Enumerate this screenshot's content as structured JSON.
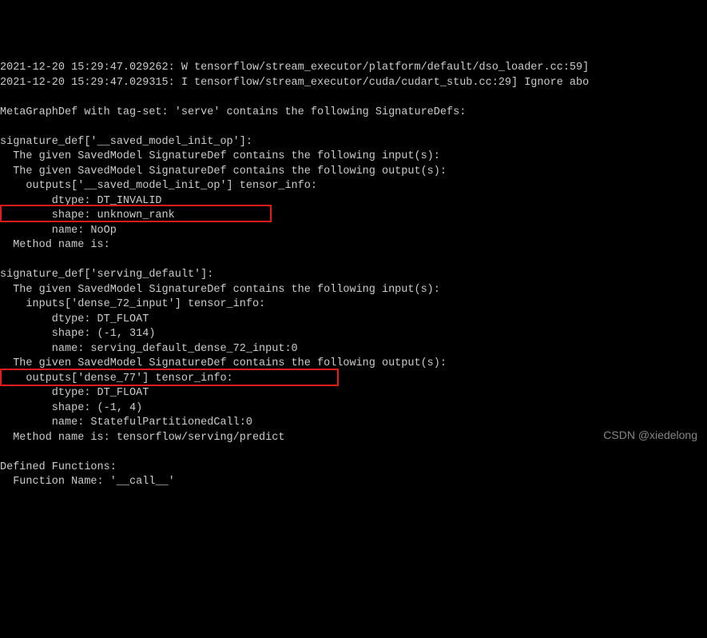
{
  "terminal": {
    "lines": [
      "2021-12-20 15:29:47.029262: W tensorflow/stream_executor/platform/default/dso_loader.cc:59]",
      "2021-12-20 15:29:47.029315: I tensorflow/stream_executor/cuda/cudart_stub.cc:29] Ignore abo",
      "",
      "MetaGraphDef with tag-set: 'serve' contains the following SignatureDefs:",
      "",
      "signature_def['__saved_model_init_op']:",
      "  The given SavedModel SignatureDef contains the following input(s):",
      "  The given SavedModel SignatureDef contains the following output(s):",
      "    outputs['__saved_model_init_op'] tensor_info:",
      "        dtype: DT_INVALID",
      "        shape: unknown_rank",
      "        name: NoOp",
      "  Method name is: ",
      "",
      "signature_def['serving_default']:",
      "  The given SavedModel SignatureDef contains the following input(s):",
      "    inputs['dense_72_input'] tensor_info:",
      "        dtype: DT_FLOAT",
      "        shape: (-1, 314)",
      "        name: serving_default_dense_72_input:0",
      "  The given SavedModel SignatureDef contains the following output(s):",
      "    outputs['dense_77'] tensor_info:",
      "        dtype: DT_FLOAT",
      "        shape: (-1, 4)",
      "        name: StatefulPartitionedCall:0",
      "  Method name is: tensorflow/serving/predict",
      "",
      "Defined Functions:",
      "  Function Name: '__call__'"
    ]
  },
  "watermark": "CSDN @xiedelong"
}
